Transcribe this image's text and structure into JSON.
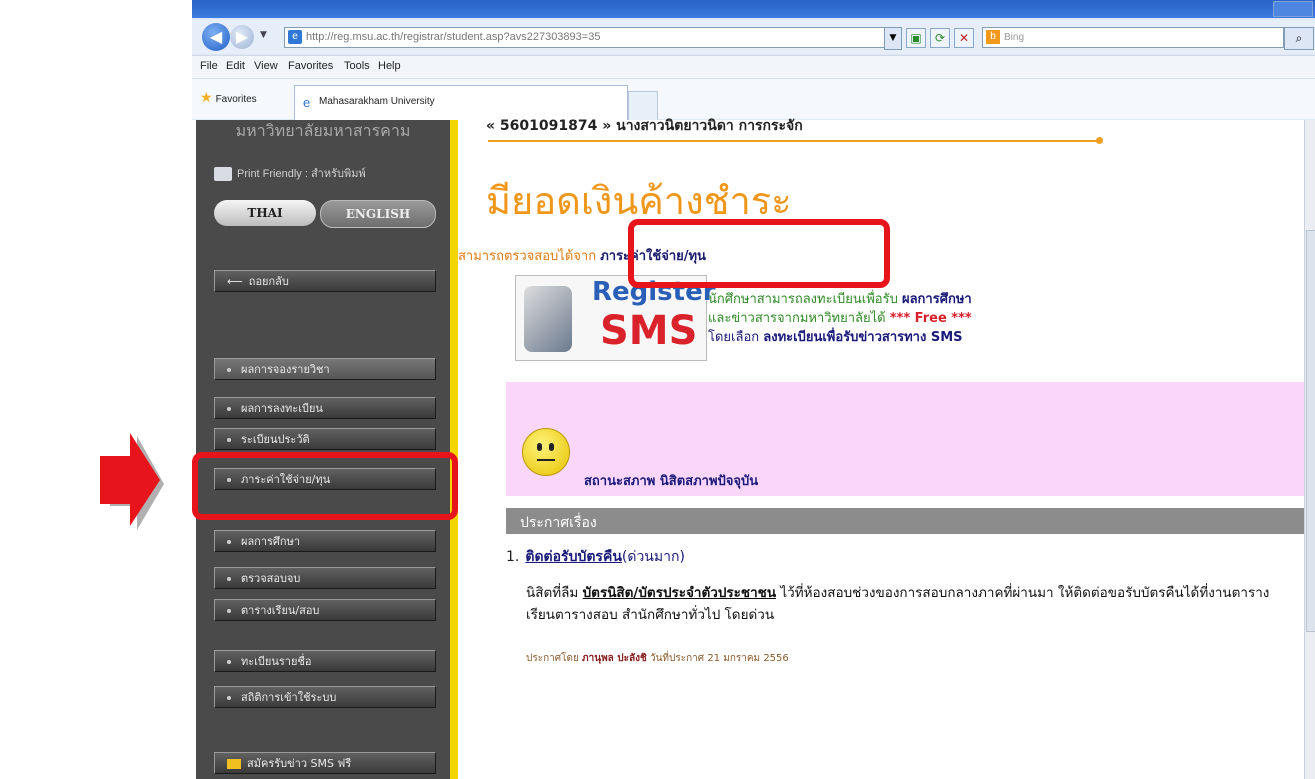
{
  "browser": {
    "url": "http://reg.msu.ac.th/registrar/student.asp?avs227303893=35",
    "search_placeholder": "Bing",
    "menu": [
      "File",
      "Edit",
      "View",
      "Favorites",
      "Tools",
      "Help"
    ],
    "favorites_label": "Favorites",
    "tab_title": "Mahasarakham University"
  },
  "sidebar": {
    "university_name": "มหาวิทยาลัยมหาสารคาม",
    "print_friendly": "Print Friendly : สำหรับพิมพ์",
    "lang_thai": "THAI",
    "lang_english": "ENGLISH",
    "back_label": "ถอยกลับ",
    "items": [
      "ผลการจองรายวิชา",
      "ผลการลงทะเบียน",
      "ระเบียนประวัติ",
      "ภาระค่าใช้จ่าย/ทุน",
      "ผลการศึกษา",
      "ตรวจสอบจบ",
      "ตารางเรียน/สอบ",
      "ทะเบียนรายชื่อ",
      "สถิติการเข้าใช้ระบบ"
    ],
    "sms_signup": "สมัครรับข่าว SMS ฟรี"
  },
  "content": {
    "student_line": "« 5601091874 » นางสาวนิตยาวนิดา การกระจัก",
    "outstanding_title": "มียอดเงินค้างชำระ",
    "check_prefix": "สามารถตรวจสอบได้จาก",
    "fees_link": "ภาระค่าใช้จ่าย/ทุน",
    "sms_logo_register": "Register",
    "sms_logo_sms": "SMS",
    "sms_line1_a": "นักศึกษาสามารถลงทะเบียนเพื่อรับ",
    "sms_line1_b": "ผลการศึกษา",
    "sms_line2_a": "และข่าวสารจากมหาวิทยาลัยได้",
    "sms_line2_b": "*** Free ***",
    "sms_line3_a": "โดยเลือก",
    "sms_line3_b": "ลงทะเบียนเพื่อรับข่าวสารทาง SMS",
    "status_text": "สถานะสภาพ นิสิตสภาพปัจจุบัน",
    "announcement_heading": "ประกาศเรื่อง",
    "announcement": {
      "number": "1.",
      "title": "ติดต่อรับบัตรคืน",
      "urgency": "(ด่วนมาก)",
      "body_pre": "นิสิตที่ลืม",
      "body_card": "บัตรนิสิต/บัตรประจำตัวประชาชน",
      "body_post": "ไว้ที่ห้องสอบช่วงของการสอบกลางภาคที่ผ่านมา ให้ติดต่อขอรับบัตรคืนได้ที่งานตารางเรียนตารางสอบ สำนักศึกษาทั่วไป โดยด่วน",
      "posted_by_label": "ประกาศโดย",
      "author": "ภานุพล ปะลังชิ",
      "date_label": "วันที่ประกาศ",
      "date": "21 มกราคม 2556"
    }
  },
  "colors": {
    "highlight_red": "#e8141c",
    "accent_orange": "#f09618",
    "sidebar_dark": "#4a4a4a",
    "status_pink": "#fbd6fb"
  }
}
